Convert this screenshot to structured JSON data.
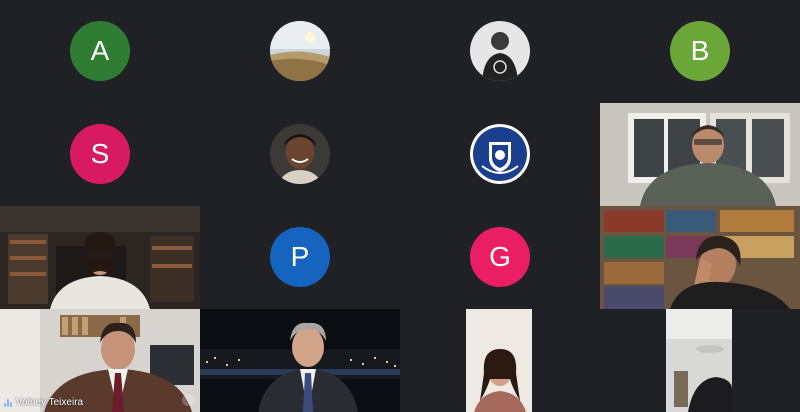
{
  "colors": {
    "background": "#202124",
    "avatar_A": "#2e7d32",
    "avatar_B": "#6aa638",
    "avatar_S": "#d81b60",
    "avatar_P": "#1565c0",
    "avatar_G": "#e91e63"
  },
  "participants": [
    {
      "initial": "A",
      "type": "letter-avatar"
    },
    {
      "type": "photo-avatar",
      "photo": "sky-landscape"
    },
    {
      "type": "photo-avatar",
      "photo": "person-portrait"
    },
    {
      "initial": "B",
      "type": "letter-avatar"
    },
    {
      "initial": "S",
      "type": "letter-avatar"
    },
    {
      "type": "photo-avatar",
      "photo": "smiling-woman"
    },
    {
      "type": "photo-avatar",
      "photo": "crest-emblem"
    },
    {
      "type": "video",
      "scene": "man-at-home"
    },
    {
      "type": "video",
      "scene": "woman-bookshelf"
    },
    {
      "initial": "P",
      "type": "letter-avatar"
    },
    {
      "initial": "G",
      "type": "letter-avatar"
    },
    {
      "type": "video",
      "scene": "man-bookshelf-thinking"
    },
    {
      "type": "video",
      "scene": "man-suit-speaking",
      "name": "Volney Teixeira"
    },
    {
      "type": "video",
      "scene": "man-suit-night-city"
    },
    {
      "type": "video",
      "scene": "young-woman"
    },
    {
      "type": "video",
      "scene": "man-dim-room"
    }
  ]
}
